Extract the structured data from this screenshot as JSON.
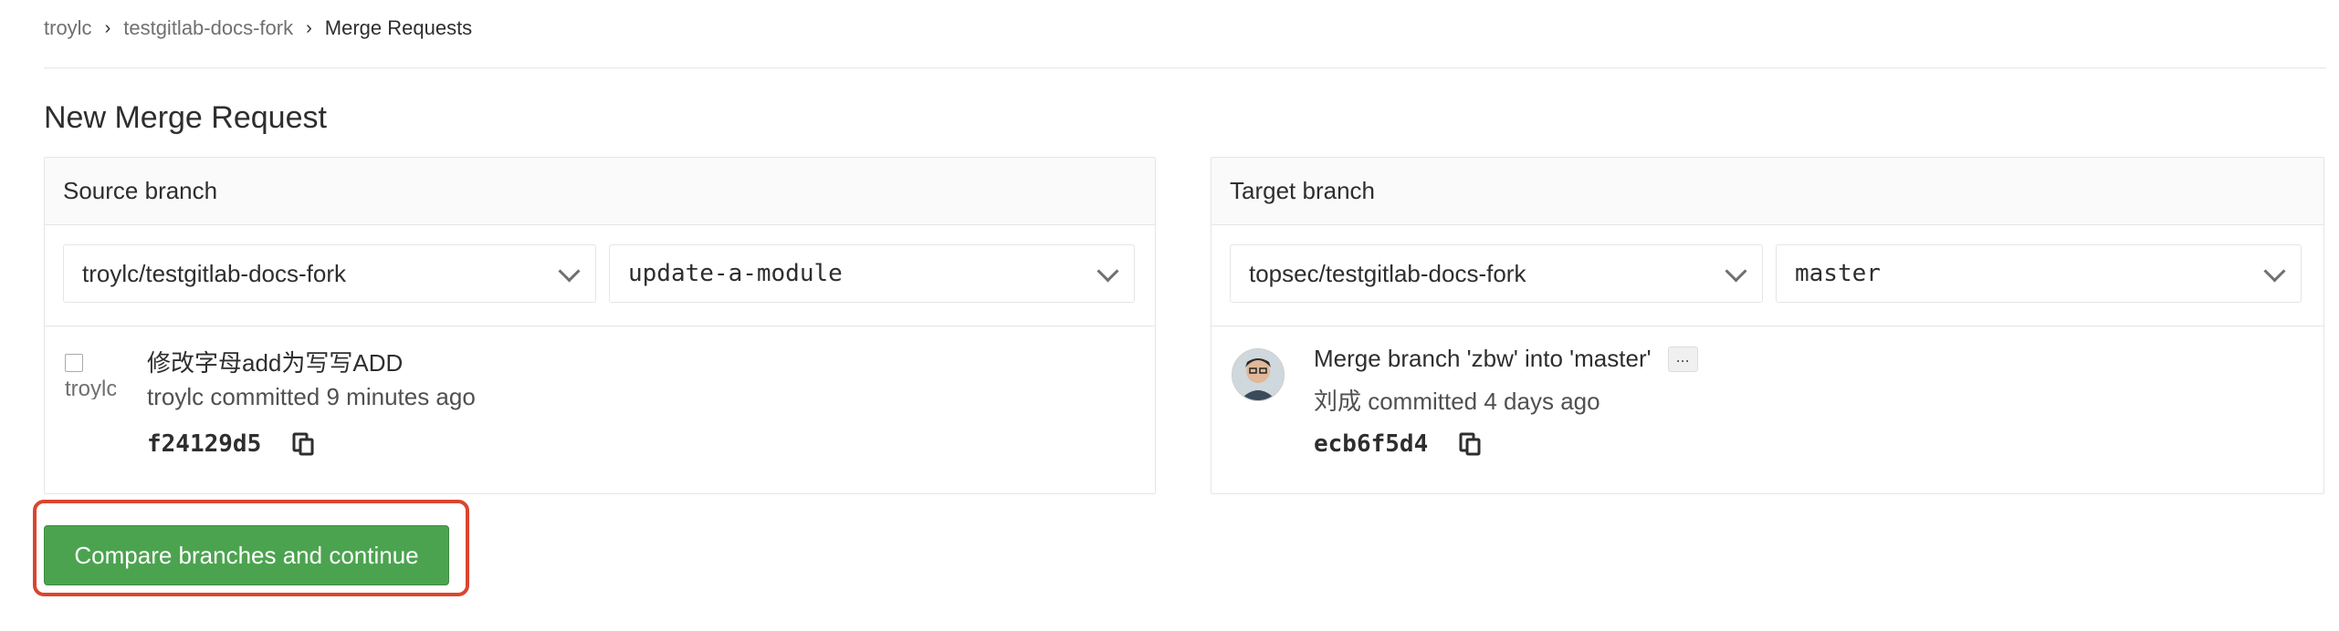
{
  "breadcrumb": {
    "items": [
      "troylc",
      "testgitlab-docs-fork",
      "Merge Requests"
    ],
    "separator": "›"
  },
  "page": {
    "title": "New Merge Request"
  },
  "source": {
    "header": "Source branch",
    "project": "troylc/testgitlab-docs-fork",
    "branch": "update-a-module",
    "avatar_alt": "troylc",
    "commit": {
      "title": "修改字母add为写写ADD",
      "meta": "troylc committed 9 minutes ago",
      "sha": "f24129d5"
    }
  },
  "target": {
    "header": "Target branch",
    "project": "topsec/testgitlab-docs-fork",
    "branch": "master",
    "commit": {
      "title": "Merge branch 'zbw' into 'master'",
      "ellipsis": "...",
      "meta": "刘成 committed 4 days ago",
      "sha": "ecb6f5d4"
    }
  },
  "actions": {
    "compare_label": "Compare branches and continue"
  },
  "colors": {
    "button_green": "#4ba34f",
    "highlight_red": "#d9452f",
    "border": "#e5e5e5"
  }
}
